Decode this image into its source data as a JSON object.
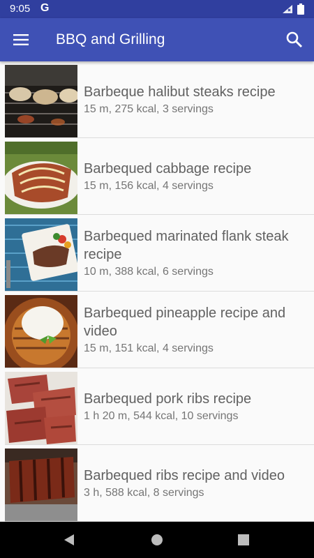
{
  "status": {
    "time": "9:05",
    "g_badge": "G"
  },
  "app_bar": {
    "title": "BBQ and Grilling"
  },
  "recipes": [
    {
      "title": "Barbeque halibut steaks recipe",
      "meta": "15 m, 275 kcal, 3 servings"
    },
    {
      "title": "Barbequed cabbage recipe",
      "meta": "15 m, 156 kcal, 4 servings"
    },
    {
      "title": "Barbequed marinated flank steak recipe",
      "meta": "10 m, 388 kcal, 6 servings"
    },
    {
      "title": "Barbequed pineapple recipe and video",
      "meta": "15 m, 151 kcal, 4 servings"
    },
    {
      "title": "Barbequed pork ribs recipe",
      "meta": "1 h 20 m, 544 kcal, 10 servings"
    },
    {
      "title": "Barbequed ribs recipe and video",
      "meta": "3 h, 588 kcal, 8 servings"
    }
  ],
  "colors": {
    "status_bar": "#303f9f",
    "app_bar": "#3f51b5",
    "background": "#fafafa"
  },
  "icons": [
    "menu-icon",
    "search-icon",
    "wifi-icon",
    "battery-icon",
    "back-icon",
    "home-icon",
    "recents-icon"
  ]
}
